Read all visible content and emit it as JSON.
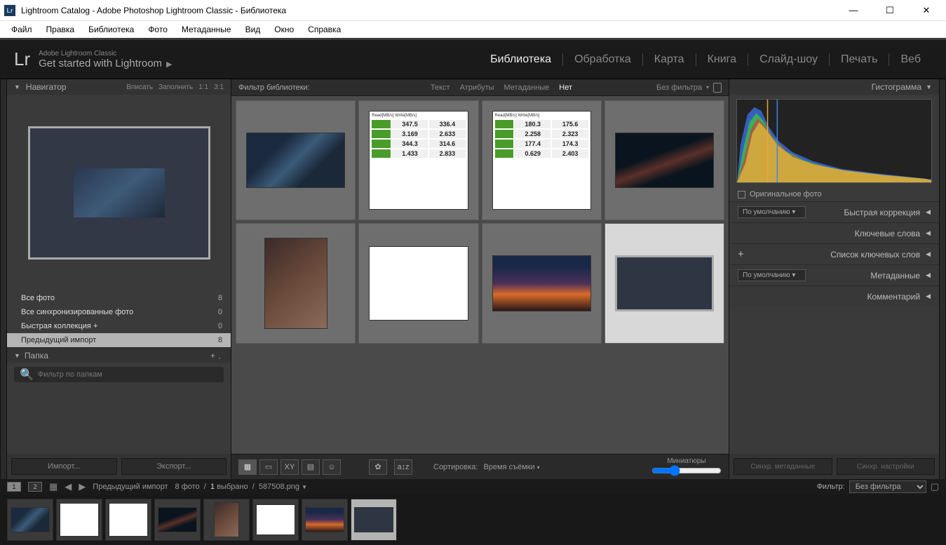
{
  "titlebar": {
    "title": "Lightroom Catalog - Adobe Photoshop Lightroom Classic - Библиотека",
    "app_icon": "Lr"
  },
  "menubar": [
    "Файл",
    "Правка",
    "Библиотека",
    "Фото",
    "Метаданные",
    "Вид",
    "Окно",
    "Справка"
  ],
  "header": {
    "logo": "Lr",
    "subtitle1": "Adobe Lightroom Classic",
    "subtitle2": "Get started with Lightroom",
    "modules": [
      "Библиотека",
      "Обработка",
      "Карта",
      "Книга",
      "Слайд-шоу",
      "Печать",
      "Веб"
    ],
    "active_module": 0
  },
  "navigator": {
    "title": "Навигатор",
    "modes": [
      "Вписать",
      "Заполнить",
      "1:1",
      "3:1"
    ]
  },
  "catalog": {
    "items": [
      {
        "label": "Все фото",
        "count": 8
      },
      {
        "label": "Все синхронизированные фото",
        "count": 0
      },
      {
        "label": "Быстрая коллекция  +",
        "count": 0
      },
      {
        "label": "Предыдущий импорт",
        "count": 8
      }
    ],
    "active": 3
  },
  "folders": {
    "title": "Папка",
    "filter_placeholder": "Фильтр по папкам"
  },
  "left_buttons": {
    "import": "Импорт...",
    "export": "Экспорт..."
  },
  "filterbar": {
    "label": "Фильтр библиотеки:",
    "tabs": [
      "Текст",
      "Атрибуты",
      "Метаданные",
      "Нет"
    ],
    "active_tab": 3,
    "preset": "Без фильтра"
  },
  "grid": {
    "items": [
      {
        "kind": "witcher"
      },
      {
        "kind": "diskmark1"
      },
      {
        "kind": "diskmark2"
      },
      {
        "kind": "witcher2"
      },
      {
        "kind": "owl"
      },
      {
        "kind": "webpage"
      },
      {
        "kind": "sunset"
      },
      {
        "kind": "navy",
        "selected": true
      }
    ]
  },
  "diskmark1": {
    "rows": [
      [
        "347.5",
        "336.4"
      ],
      [
        "3.169",
        "2.633"
      ],
      [
        "344.3",
        "314.6"
      ],
      [
        "1.433",
        "2.833"
      ]
    ]
  },
  "diskmark2": {
    "rows": [
      [
        "180.3",
        "175.6"
      ],
      [
        "2.258",
        "2.323"
      ],
      [
        "177.4",
        "174.3"
      ],
      [
        "0.629",
        "2.403"
      ]
    ]
  },
  "grid_toolbar": {
    "sort_label": "Сортировка:",
    "sort_value": "Время съёмки",
    "thumbs_label": "Миниатюры"
  },
  "right": {
    "histogram_title": "Гистограмма",
    "original_photo_label": "Оригинальное фото",
    "sections": {
      "quick_dev": "Быстрая коррекция",
      "quick_dev_preset": "По умолчанию",
      "keywords": "Ключевые слова",
      "keyword_list": "Список ключевых слов",
      "metadata": "Метаданные",
      "metadata_preset": "По умолчанию",
      "comments": "Комментарий"
    },
    "buttons": {
      "sync_meta": "Синхр. метаданные",
      "sync_settings": "Синхр. настройки"
    }
  },
  "filmstrip": {
    "source": "Предыдущий импорт",
    "counts": {
      "total": "8 фото",
      "selected_prefix": "1",
      "selected_suffix": " выбрано"
    },
    "filename": "587508.png",
    "filter_label": "Фильтр:",
    "filter_value": "Без фильтра",
    "monitors": [
      "1",
      "2"
    ]
  }
}
